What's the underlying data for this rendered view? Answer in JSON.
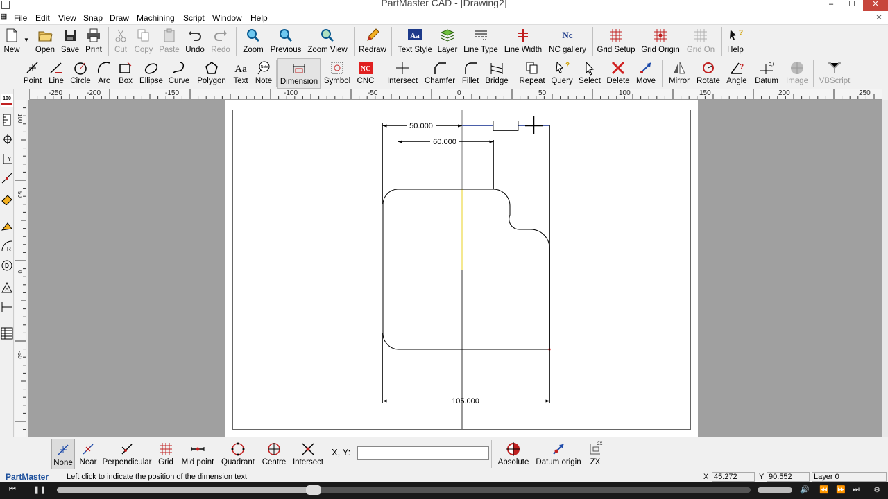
{
  "window": {
    "title": "PartMaster CAD - [Drawing2]",
    "controls": [
      "–",
      "☐",
      "✕"
    ]
  },
  "menu": [
    "File",
    "Edit",
    "View",
    "Snap",
    "Draw",
    "Machining",
    "Script",
    "Window",
    "Help"
  ],
  "mdi_close": "✕",
  "toolbar_main": [
    {
      "label": "New",
      "icon": "new-document-icon",
      "enabled": true
    },
    {
      "label": "Open",
      "icon": "folder-open-icon",
      "enabled": true
    },
    {
      "label": "Save",
      "icon": "floppy-disk-icon",
      "enabled": true
    },
    {
      "label": "Print",
      "icon": "printer-icon",
      "enabled": true
    },
    {
      "label": "Cut",
      "icon": "scissors-icon",
      "enabled": false
    },
    {
      "label": "Copy",
      "icon": "copy-icon",
      "enabled": false
    },
    {
      "label": "Paste",
      "icon": "paste-icon",
      "enabled": false
    },
    {
      "label": "Undo",
      "icon": "undo-icon",
      "enabled": true
    },
    {
      "label": "Redo",
      "icon": "redo-icon",
      "enabled": false
    },
    {
      "label": "Zoom",
      "icon": "zoom-icon",
      "enabled": true
    },
    {
      "label": "Previous",
      "icon": "zoom-previous-icon",
      "enabled": true
    },
    {
      "label": "Zoom View",
      "icon": "zoom-view-icon",
      "enabled": true
    },
    {
      "label": "Redraw",
      "icon": "pencil-redraw-icon",
      "enabled": true
    },
    {
      "label": "Text Style",
      "icon": "text-style-icon",
      "enabled": true
    },
    {
      "label": "Layer",
      "icon": "layers-icon",
      "enabled": true
    },
    {
      "label": "Line Type",
      "icon": "line-type-icon",
      "enabled": true
    },
    {
      "label": "Line Width",
      "icon": "line-width-icon",
      "enabled": true
    },
    {
      "label": "NC gallery",
      "icon": "nc-gallery-icon",
      "enabled": true
    },
    {
      "label": "Grid Setup",
      "icon": "grid-setup-icon",
      "enabled": true
    },
    {
      "label": "Grid Origin",
      "icon": "grid-origin-icon",
      "enabled": true
    },
    {
      "label": "Grid On",
      "icon": "grid-on-icon",
      "enabled": false
    },
    {
      "label": "Help",
      "icon": "help-pointer-icon",
      "enabled": true
    }
  ],
  "toolbar_draw": [
    {
      "label": "Point",
      "icon": "point-icon",
      "enabled": true
    },
    {
      "label": "Line",
      "icon": "line-icon",
      "enabled": true
    },
    {
      "label": "Circle",
      "icon": "circle-icon",
      "enabled": true
    },
    {
      "label": "Arc",
      "icon": "arc-icon",
      "enabled": true
    },
    {
      "label": "Box",
      "icon": "box-icon",
      "enabled": true
    },
    {
      "label": "Ellipse",
      "icon": "ellipse-icon",
      "enabled": true
    },
    {
      "label": "Curve",
      "icon": "curve-icon",
      "enabled": true
    },
    {
      "label": "Polygon",
      "icon": "polygon-icon",
      "enabled": true
    },
    {
      "label": "Text",
      "icon": "text-icon",
      "enabled": true
    },
    {
      "label": "Note",
      "icon": "note-icon",
      "enabled": true
    },
    {
      "label": "Dimension",
      "icon": "dimension-icon",
      "enabled": true
    },
    {
      "label": "Symbol",
      "icon": "symbol-icon",
      "enabled": true
    },
    {
      "label": "CNC",
      "icon": "cnc-icon",
      "enabled": true
    },
    {
      "label": "Intersect",
      "icon": "intersect-icon",
      "enabled": true
    },
    {
      "label": "Chamfer",
      "icon": "chamfer-icon",
      "enabled": true
    },
    {
      "label": "Fillet",
      "icon": "fillet-icon",
      "enabled": true
    },
    {
      "label": "Bridge",
      "icon": "bridge-icon",
      "enabled": true
    },
    {
      "label": "Repeat",
      "icon": "repeat-icon",
      "enabled": true
    },
    {
      "label": "Query",
      "icon": "query-icon",
      "enabled": true
    },
    {
      "label": "Select",
      "icon": "select-arrow-icon",
      "enabled": true
    },
    {
      "label": "Delete",
      "icon": "delete-icon",
      "enabled": true
    },
    {
      "label": "Move",
      "icon": "move-icon",
      "enabled": true
    },
    {
      "label": "Mirror",
      "icon": "mirror-icon",
      "enabled": true
    },
    {
      "label": "Rotate",
      "icon": "rotate-icon",
      "enabled": true
    },
    {
      "label": "Angle",
      "icon": "angle-icon",
      "enabled": true
    },
    {
      "label": "Datum",
      "icon": "datum-icon",
      "enabled": true
    },
    {
      "label": "Image",
      "icon": "image-icon",
      "enabled": false
    },
    {
      "label": "VBScript",
      "icon": "vbscript-icon",
      "enabled": false
    }
  ],
  "active_tool": "Dimension",
  "ruler": {
    "h_labels": [
      "-250",
      "-200",
      "-150",
      "-100",
      "-50",
      "0",
      "50",
      "100",
      "150",
      "200",
      "250"
    ],
    "v_labels": [
      "100",
      "50",
      "0",
      "-50"
    ]
  },
  "drawing": {
    "dimensions": [
      "50.000",
      "60.000",
      "105.000"
    ],
    "datum_x_label": "0.0"
  },
  "snap_bar": {
    "buttons": [
      {
        "label": "None",
        "icon": "snap-none-icon",
        "active": true
      },
      {
        "label": "Near",
        "icon": "snap-near-icon",
        "active": false
      },
      {
        "label": "Perpendicular",
        "icon": "snap-perpendicular-icon",
        "active": false
      },
      {
        "label": "Grid",
        "icon": "snap-grid-icon",
        "active": false
      },
      {
        "label": "Mid point",
        "icon": "snap-midpoint-icon",
        "active": false
      },
      {
        "label": "Quadrant",
        "icon": "snap-quadrant-icon",
        "active": false
      },
      {
        "label": "Centre",
        "icon": "snap-centre-icon",
        "active": false
      },
      {
        "label": "Intersect",
        "icon": "snap-intersect-icon",
        "active": false
      }
    ],
    "xy_label": "X, Y:",
    "xy_value": "",
    "right_buttons": [
      {
        "label": "Absolute",
        "icon": "absolute-icon"
      },
      {
        "label": "Datum origin",
        "icon": "datum-origin-icon"
      },
      {
        "label": "ZX",
        "icon": "zx-plane-icon"
      }
    ]
  },
  "status": {
    "app": "PartMaster",
    "message": "Left click to indicate the position of the dimension text",
    "x_label": "X",
    "x_value": "45.272",
    "y_label": "Y",
    "y_value": "90.552",
    "layer": "Layer 0"
  },
  "video_player": {
    "progress": 0.37
  },
  "colors": {
    "active_dimension": "#4a5ea8",
    "datum_vertical": "#e8d020",
    "close_button": "#c7463c",
    "canvas_bg": "#a0a0a0",
    "brand_text": "#1c4f9c"
  }
}
